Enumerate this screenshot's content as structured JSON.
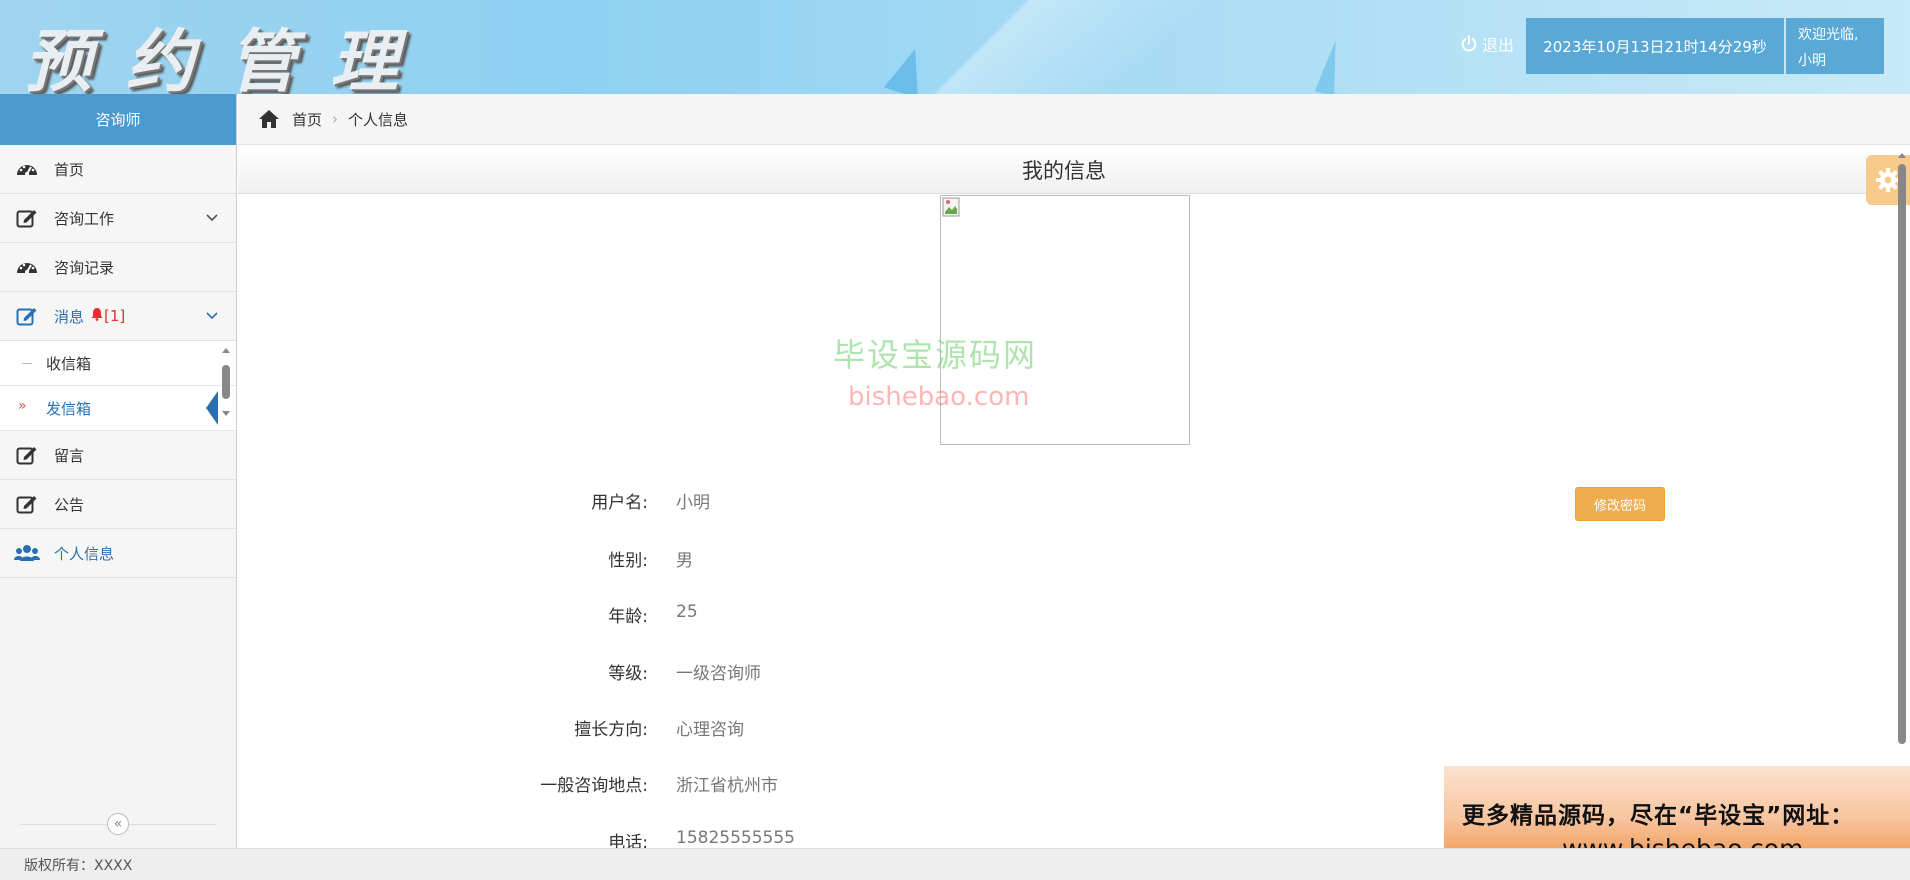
{
  "header": {
    "title": "预约管理",
    "logout_label": "退出",
    "datetime": "2023年10月13日21时14分29秒",
    "welcome_line1": "欢迎光临,",
    "welcome_line2": "小明"
  },
  "sidebar": {
    "role": "咨询师",
    "items": [
      {
        "label": "首页",
        "icon": "dashboard-icon"
      },
      {
        "label": "咨询工作",
        "icon": "edit-icon"
      },
      {
        "label": "咨询记录",
        "icon": "dashboard-icon"
      },
      {
        "label": "消息",
        "icon": "edit-icon",
        "badge": "[1]"
      },
      {
        "label": "留言",
        "icon": "edit-icon"
      },
      {
        "label": "公告",
        "icon": "edit-icon"
      },
      {
        "label": "个人信息",
        "icon": "users-icon"
      }
    ],
    "sub_items": [
      {
        "label": "收信箱"
      },
      {
        "label": "发信箱"
      }
    ],
    "collapse_glyph": "«"
  },
  "breadcrumb": {
    "home": "首页",
    "current": "个人信息",
    "separator": "›"
  },
  "main": {
    "panel_title": "我的信息",
    "change_password_label": "修改密码",
    "fields": [
      {
        "label": "用户名:",
        "value": "小明"
      },
      {
        "label": "性别:",
        "value": "男"
      },
      {
        "label": "年龄:",
        "value": "25"
      },
      {
        "label": "等级:",
        "value": "一级咨询师"
      },
      {
        "label": "擅长方向:",
        "value": "心理咨询"
      },
      {
        "label": "一般咨询地点:",
        "value": "浙江省杭州市"
      },
      {
        "label": "电话:",
        "value": "15825555555"
      }
    ]
  },
  "watermark": {
    "line1": "毕设宝源码网",
    "line2": "bishebao.com"
  },
  "ad": {
    "line1": "更多精品源码，尽在“毕设宝”网址：",
    "line2": "www.bishebao.com"
  },
  "footer": {
    "copyright": "版权所有：XXXX"
  },
  "colors": {
    "accent_blue": "#4a99cf",
    "active_link": "#2a6fb0",
    "button_orange": "#f0ad4e",
    "badge_red": "#e0312f"
  }
}
